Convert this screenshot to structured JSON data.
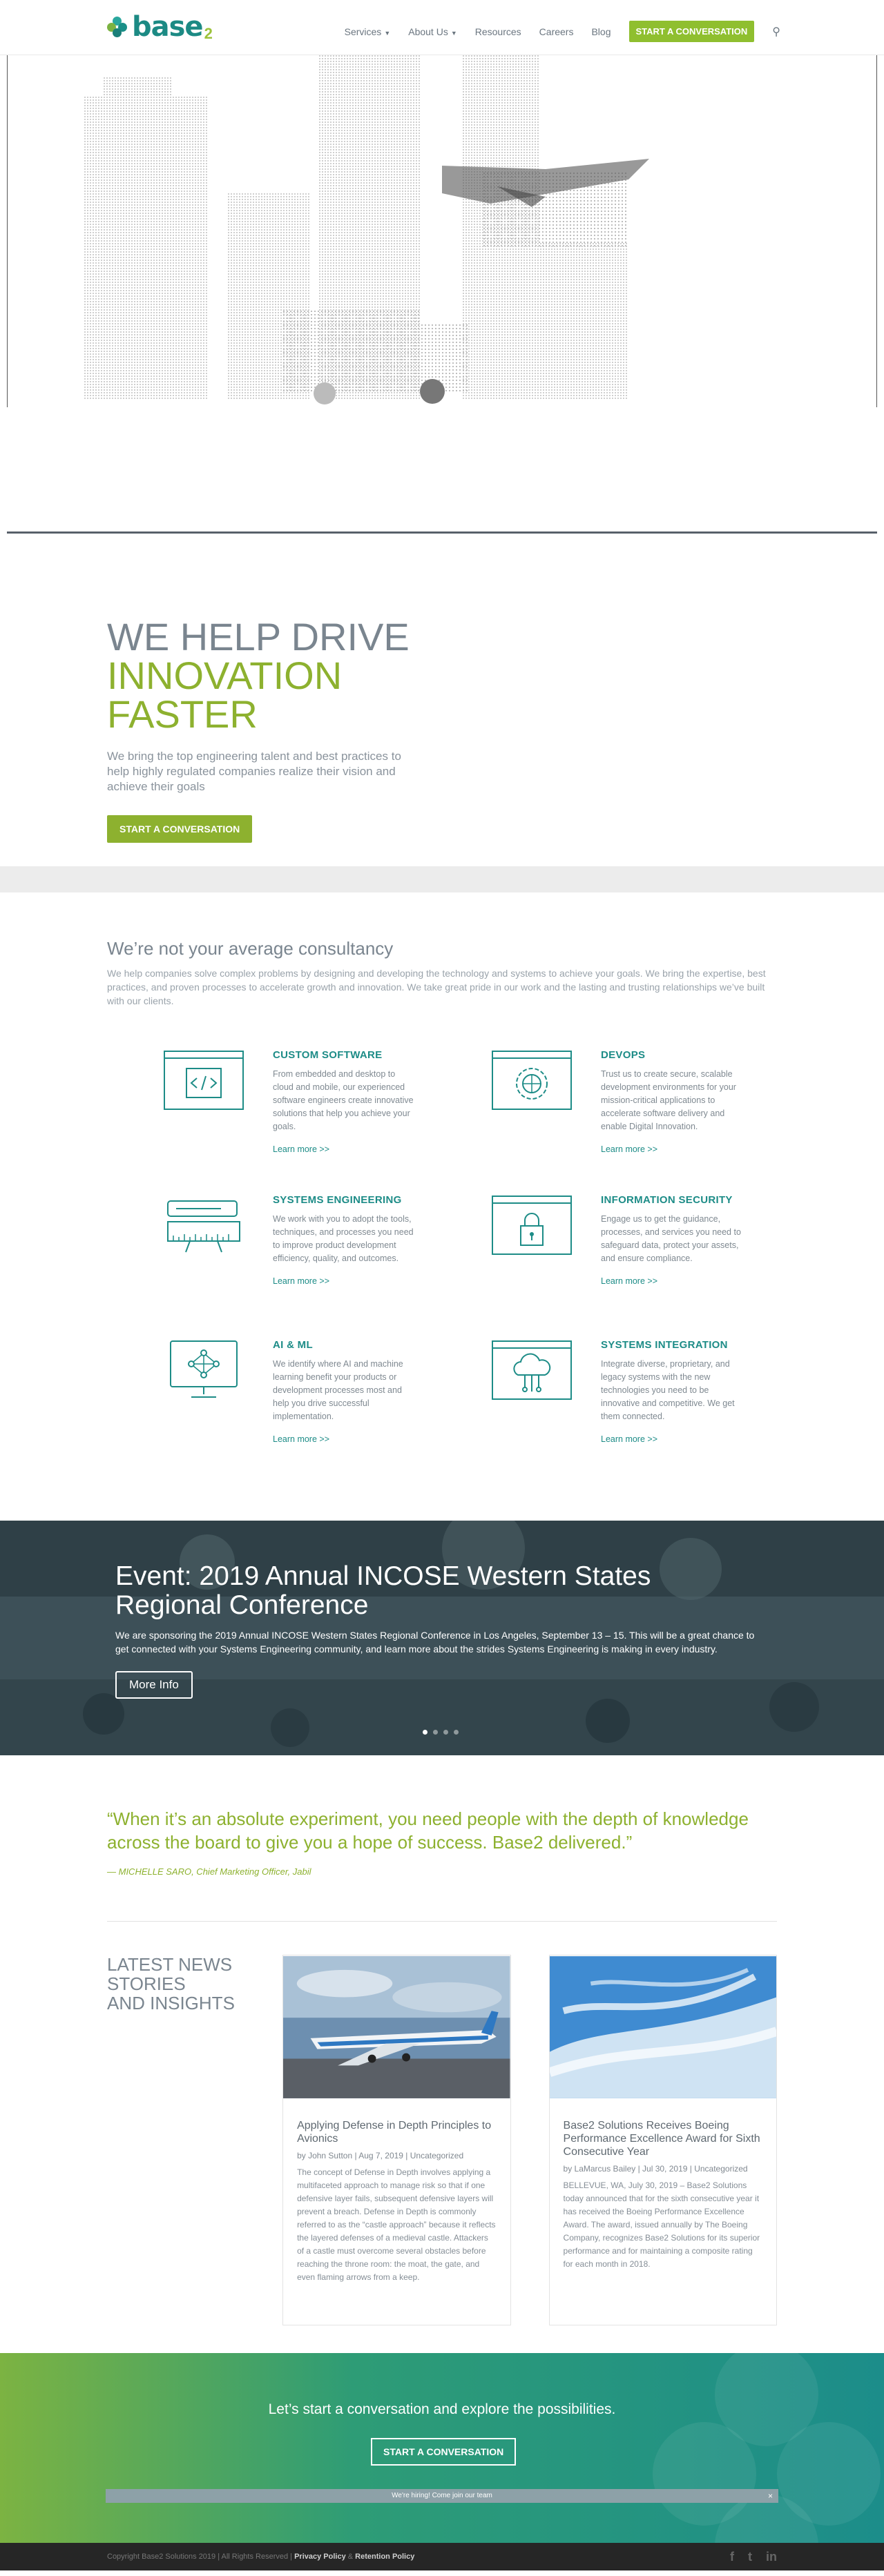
{
  "brand": {
    "name": "base",
    "suffix": "2"
  },
  "nav": {
    "items": [
      {
        "label": "Services",
        "has_dropdown": true
      },
      {
        "label": "About Us",
        "has_dropdown": true
      },
      {
        "label": "Resources"
      },
      {
        "label": "Careers"
      },
      {
        "label": "Blog"
      }
    ],
    "cta_label": "START A CONVERSATION",
    "search_icon": "search-icon"
  },
  "intro": {
    "headline_line1": "WE HELP DRIVE",
    "headline_line2": "INNOVATION",
    "headline_line3": "FASTER",
    "body": "We bring the top engineering talent and best practices to help highly regulated companies realize their vision and achieve their goals",
    "cta_label": "START A CONVERSATION"
  },
  "consultancy": {
    "title": "We’re not your average consultancy",
    "lead": "We help companies solve complex problems by designing and developing the technology and systems to achieve your goals. We bring the expertise, best practices, and proven processes to accelerate growth and innovation. We take great pride in our work and the lasting and trusting relationships we’ve built with our clients.",
    "services": [
      {
        "title": "CUSTOM SOFTWARE",
        "icon": "code-window-icon",
        "desc": "From embedded and desktop to cloud and mobile, our experienced software engineers create innovative solutions that help you achieve your goals.",
        "link": "Learn more >>"
      },
      {
        "title": "DEVOPS",
        "icon": "gear-window-icon",
        "desc": "Trust us to create secure, scalable development environments for your mission-critical applications to accelerate software delivery and enable Digital Innovation.",
        "link": "Learn more >>"
      },
      {
        "title": "SYSTEMS ENGINEERING",
        "icon": "blueprint-icon",
        "desc": "We work with you to adopt the tools, techniques, and processes you need to improve product development efficiency, quality, and outcomes.",
        "link": "Learn more >>"
      },
      {
        "title": "INFORMATION SECURITY",
        "icon": "lock-window-icon",
        "desc": "Engage us to get the guidance, processes, and services you need to safeguard data, protect your assets, and ensure compliance.",
        "link": "Learn more >>"
      },
      {
        "title": "AI & ML",
        "icon": "neural-network-icon",
        "desc": "We identify where AI and machine learning benefit your products or development processes most and help you drive successful implementation.",
        "link": "Learn more >>"
      },
      {
        "title": "SYSTEMS INTEGRATION",
        "icon": "cloud-window-icon",
        "desc": "Integrate diverse, proprietary, and legacy systems with the new technologies you need to be innovative and competitive. We get them connected.",
        "link": "Learn more >>"
      }
    ]
  },
  "event": {
    "title": "Event: 2019 Annual INCOSE Western States Regional Conference",
    "body": "We are sponsoring the 2019 Annual INCOSE Western States Regional Conference in Los Angeles, September 13 – 15. This will be a great chance to get connected with your Systems Engineering community, and learn more about the strides Systems Engineering is making in every industry.",
    "button": "More Info",
    "slides": 4,
    "active_slide": 1
  },
  "quote": {
    "text": "“When it’s an absolute experiment, you need people with the depth of knowledge across the board to give you a hope of success. Base2 delivered.”",
    "cite": "— MICHELLE SARO, Chief Marketing Officer, Jabil"
  },
  "news": {
    "title_line1": "LATEST NEWS",
    "title_line2": "STORIES",
    "title_line3": "AND INSIGHTS",
    "posts": [
      {
        "title": "Applying Defense in Depth Principles to Avionics",
        "meta": "by John Sutton | Aug 7, 2019 | Uncategorized",
        "excerpt": "The concept of Defense in Depth involves applying a multifaceted approach to manage risk so that if one defensive layer fails, subsequent defensive layers will prevent a breach. Defense in Depth is commonly referred to as the “castle approach” because it reflects the layered defenses of a medieval castle. Attackers of a castle must overcome several obstacles before reaching the throne room: the moat, the gate, and even flaming arrows from a keep."
      },
      {
        "title": "Base2 Solutions Receives Boeing Performance Excellence Award for Sixth Consecutive Year",
        "meta": "by LaMarcus Bailey | Jul 30, 2019 | Uncategorized",
        "excerpt": "BELLEVUE, WA, July 30, 2019 – Base2 Solutions today announced that for the sixth consecutive year it has received the Boeing Performance Excellence Award. The award, issued annually by The Boeing Company, recognizes Base2 Solutions for its superior performance and for maintaining a composite rating for each month in 2018."
      }
    ]
  },
  "cta": {
    "headline": "Let’s start a conversation and explore the possibilities.",
    "button": "START A CONVERSATION",
    "hiring_bar": "We're hiring! Come join our team",
    "close": "×"
  },
  "footer": {
    "copyright": "Copyright Base2 Solutions 2019 | All Rights Reserved |",
    "privacy": "Privacy Policy",
    "amp": "&",
    "retention": "Retention Policy",
    "social": [
      "f",
      "t",
      "in"
    ]
  },
  "colors": {
    "teal": "#1d8c87",
    "green": "#8db12f",
    "gray": "#7a858f"
  }
}
